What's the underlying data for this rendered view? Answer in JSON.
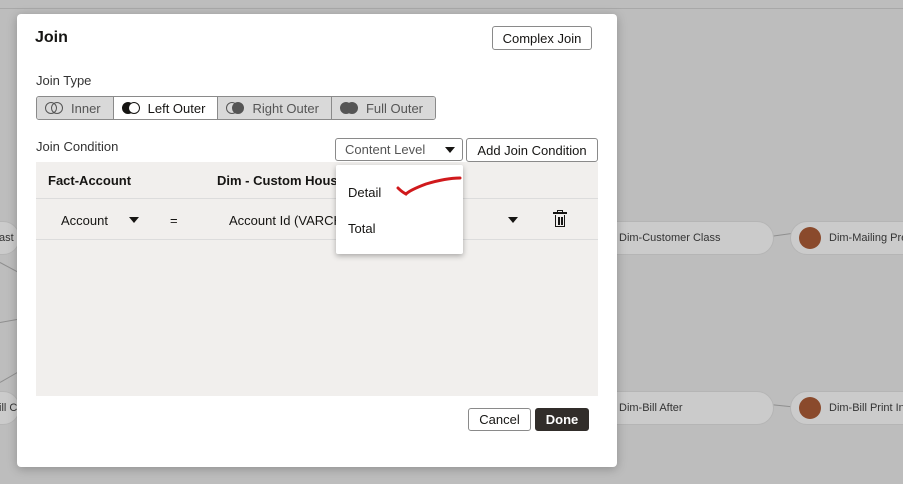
{
  "background": {
    "nodes": [
      "ast",
      "Dim-Customer Class",
      "Dim-Mailing Pre",
      "ill C",
      "Dim-Bill After",
      "Dim-Bill Print In"
    ]
  },
  "dialog": {
    "title": "Join",
    "complex_join_label": "Complex Join",
    "join_type_label": "Join Type",
    "join_types": [
      "Inner",
      "Left Outer",
      "Right Outer",
      "Full Outer"
    ],
    "selected_join_type": "Left Outer",
    "join_condition_label": "Join Condition",
    "content_level": {
      "placeholder": "Content Level",
      "options": [
        "Detail",
        "Total"
      ]
    },
    "add_join_condition_label": "Add Join Condition",
    "table": {
      "left_header": "Fact-Account",
      "right_header": "Dim - Custom House",
      "rows": [
        {
          "left": "Account",
          "operator": "=",
          "right": "Account Id (VARCH"
        }
      ]
    },
    "cancel_label": "Cancel",
    "done_label": "Done"
  },
  "colors": {
    "primary_button": "#312d2a",
    "annotation": "#d0191c",
    "node_dot": "#8a4a2c"
  }
}
